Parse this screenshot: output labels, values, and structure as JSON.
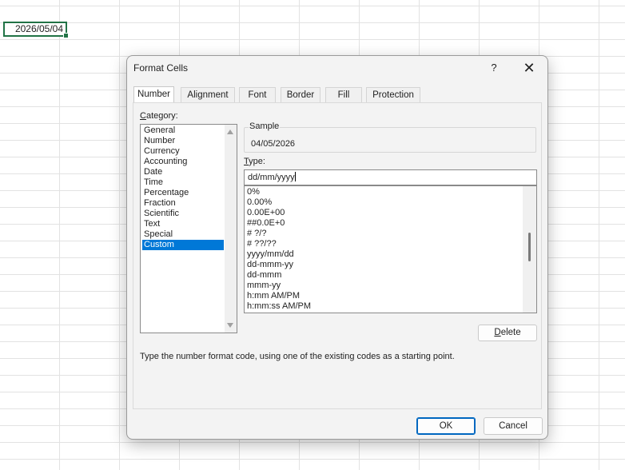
{
  "sheet": {
    "active_cell_value": "2026/05/04"
  },
  "dialog": {
    "title": "Format Cells",
    "help_label": "?",
    "close_label": "✕",
    "tabs": [
      "Number",
      "Alignment",
      "Font",
      "Border",
      "Fill",
      "Protection"
    ],
    "active_tab": "Number",
    "category_label_first": "C",
    "category_label_rest": "ategory:",
    "categories": [
      "General",
      "Number",
      "Currency",
      "Accounting",
      "Date",
      "Time",
      "Percentage",
      "Fraction",
      "Scientific",
      "Text",
      "Special",
      "Custom"
    ],
    "selected_category": "Custom",
    "sample_label": "Sample",
    "sample_value": "04/05/2026",
    "type_label_first": "T",
    "type_label_rest": "ype:",
    "type_value": "dd/mm/yyyy",
    "format_codes": [
      "0%",
      "0.00%",
      "0.00E+00",
      "##0.0E+0",
      "# ?/?",
      "# ??/??",
      "yyyy/mm/dd",
      "dd-mmm-yy",
      "dd-mmm",
      "mmm-yy",
      "h:mm AM/PM",
      "h:mm:ss AM/PM"
    ],
    "delete_label_first": "D",
    "delete_label_rest": "elete",
    "hint": "Type the number format code, using one of the existing codes as a starting point.",
    "ok_label": "OK",
    "cancel_label": "Cancel"
  },
  "colors": {
    "accent": "#0078d7",
    "cell_border": "#217346"
  },
  "icons": {
    "scroll_up": "triangle-up",
    "scroll_down": "triangle-down"
  }
}
